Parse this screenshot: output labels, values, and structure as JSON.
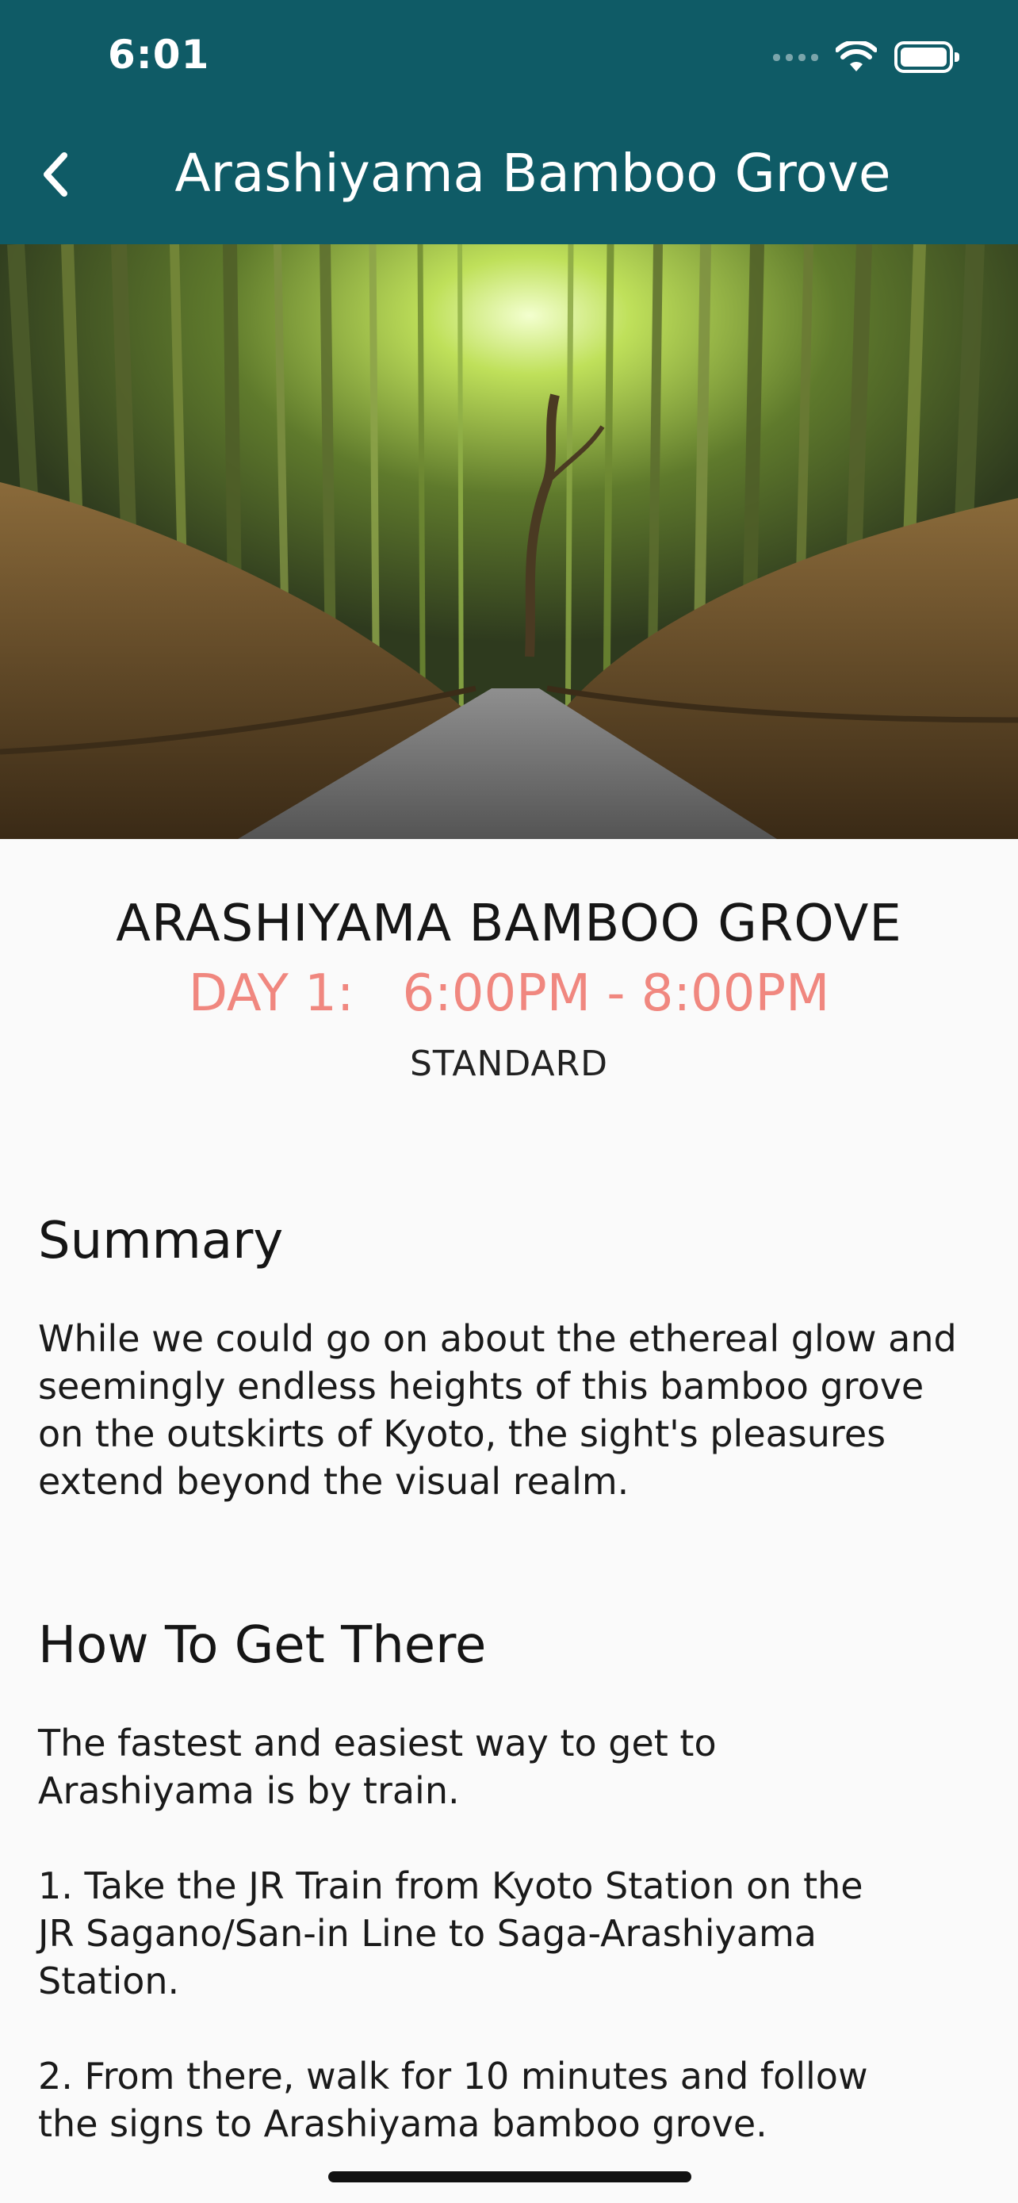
{
  "status_bar": {
    "time": "6:01",
    "icons": [
      "signal-icon",
      "wifi-icon",
      "battery-icon"
    ]
  },
  "nav": {
    "back_icon": "chevron-left-icon",
    "title": "Arashiyama Bamboo Grove",
    "background_color": "#0f5b66"
  },
  "hero_image": {
    "subject": "bamboo forest path"
  },
  "details": {
    "title": "ARASHIYAMA BAMBOO GROVE",
    "day_time": "DAY 1:   6:00PM - 8:00PM",
    "tier": "STANDARD",
    "accent_color": "#f0877f"
  },
  "summary": {
    "heading": "Summary",
    "text": "While we could go on about the ethereal glow and seemingly endless heights of this bamboo grove on the outskirts of Kyoto, the sight's pleasures extend beyond the visual realm."
  },
  "directions": {
    "heading": "How To Get There",
    "intro": "The fastest and easiest way to get to\nArashiyama is by train.",
    "step1": "1.  Take the JR Train from Kyoto Station on the\nJR Sagano/San-in Line to Saga-Arashiyama\nStation.",
    "step2": "2.  From there, walk for 10 minutes and follow\nthe signs to Arashiyama bamboo grove."
  }
}
